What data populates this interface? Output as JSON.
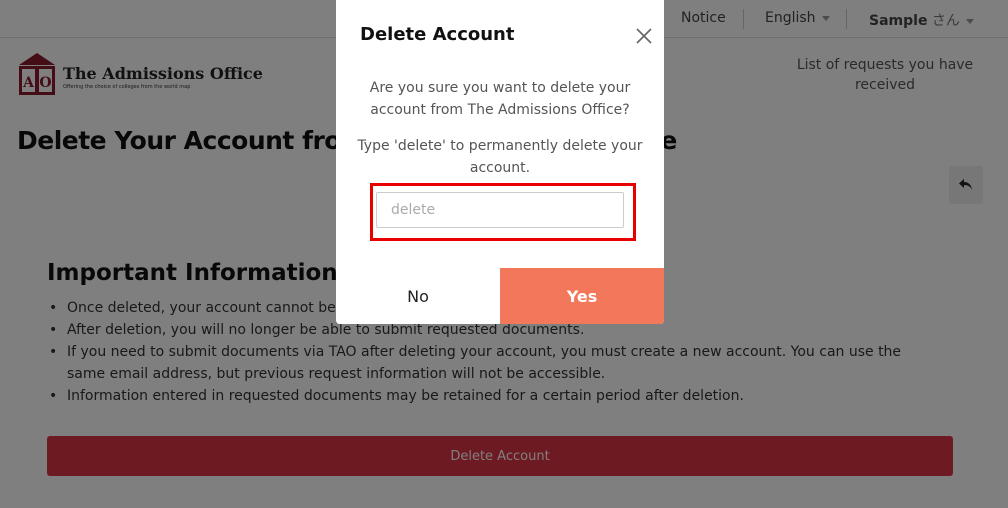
{
  "topbar": {
    "notice": "Notice",
    "language": "English",
    "user_name": "Sample",
    "user_suffix": "さん"
  },
  "header": {
    "logo_title": "The Admissions Office",
    "logo_tagline": "Offering the choice of colleges from the world map",
    "logo_mark_text": "AO",
    "requests_link": "List of requests you have received"
  },
  "main": {
    "page_title": "Delete Your Account from The Admissions Office",
    "info_heading": "Important Information About Account Deletion",
    "info_items": [
      "Once deleted, your account cannot be restored.",
      "After deletion, you will no longer be able to submit requested documents.",
      "If you need to submit documents via TAO after deleting your account, you must create a new account. You can use the same email address, but previous request information will not be accessible.",
      "Information entered in requested documents may be retained for a certain period after deletion."
    ],
    "delete_button": "Delete Account"
  },
  "modal": {
    "title": "Delete Account",
    "question": "Are you sure you want to delete your account from The Admissions Office?",
    "instruction": "Type 'delete' to permanently delete your account.",
    "input_placeholder": "delete",
    "input_value": "",
    "no_label": "No",
    "yes_label": "Yes"
  },
  "colors": {
    "yes_button": "#f2775b",
    "delete_bar": "#dc3545",
    "highlight": "#e60000",
    "logo": "#8b1a2b"
  },
  "icons": {
    "close": "close-icon",
    "back": "back-arrow-icon",
    "caret": "chevron-down-icon"
  }
}
